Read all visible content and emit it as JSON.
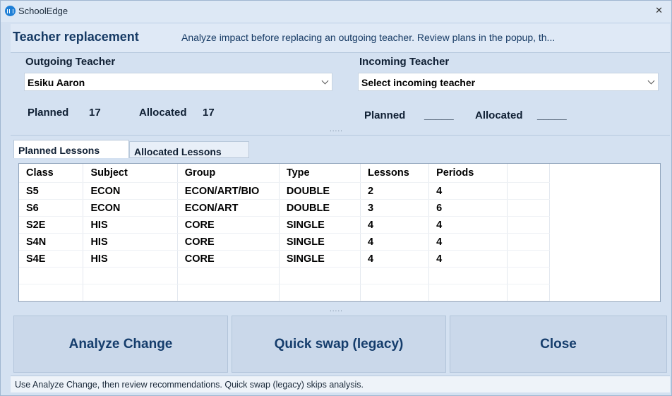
{
  "window": {
    "title": "SchoolEdge",
    "close_glyph": "✕"
  },
  "header": {
    "title": "Teacher replacement",
    "description": "Analyze impact before replacing an outgoing teacher. Review plans in the popup, th..."
  },
  "outgoing": {
    "label": "Outgoing Teacher",
    "selected": "Esiku Aaron",
    "planned_label": "Planned",
    "planned_value": "17",
    "allocated_label": "Allocated",
    "allocated_value": "17"
  },
  "incoming": {
    "label": "Incoming Teacher",
    "selected": "Select incoming teacher",
    "planned_label": "Planned",
    "planned_value": "_____",
    "allocated_label": "Allocated",
    "allocated_value": "_____"
  },
  "splitter": {
    "dots": "....."
  },
  "tabs": [
    {
      "label": "Planned Lessons",
      "active": true
    },
    {
      "label": "Allocated Lessons",
      "active": false
    }
  ],
  "table": {
    "columns": [
      "Class",
      "Subject",
      "Group",
      "Type",
      "Lessons",
      "Periods",
      ""
    ],
    "rows": [
      [
        "S5",
        "ECON",
        "ECON/ART/BIO",
        "DOUBLE",
        "2",
        "4",
        ""
      ],
      [
        "S6",
        "ECON",
        "ECON/ART",
        "DOUBLE",
        "3",
        "6",
        ""
      ],
      [
        "S2E",
        "HIS",
        "CORE",
        "SINGLE",
        "4",
        "4",
        ""
      ],
      [
        "S4N",
        "HIS",
        "CORE",
        "SINGLE",
        "4",
        "4",
        ""
      ],
      [
        "S4E",
        "HIS",
        "CORE",
        "SINGLE",
        "4",
        "4",
        ""
      ],
      [
        "",
        "",
        "",
        "",
        "",
        "",
        ""
      ],
      [
        "",
        "",
        "",
        "",
        "",
        "",
        ""
      ]
    ]
  },
  "buttons": {
    "analyze": "Analyze Change",
    "quick_swap": "Quick swap (legacy)",
    "close": "Close"
  },
  "status_text": "Use Analyze Change, then review recommendations. Quick swap (legacy) skips analysis.",
  "colors": {
    "accent": "#163a64",
    "button_bg": "#cad8ea",
    "window_bg": "#d4e1f1"
  },
  "icons": {
    "app": "book-icon",
    "close": "close-icon",
    "dropdown": "chevron-down-icon"
  }
}
